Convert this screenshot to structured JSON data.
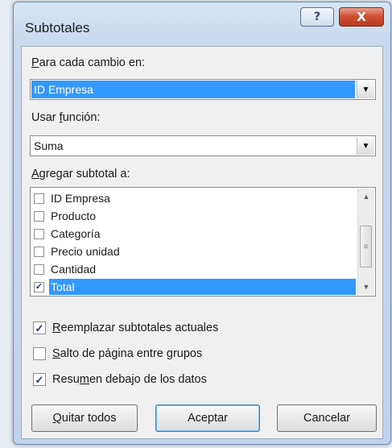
{
  "dialog": {
    "title": "Subtotales",
    "help_glyph": "?",
    "close_glyph": "X"
  },
  "group_by": {
    "label_first": "P",
    "label_rest": "ara cada cambio en:",
    "value": "ID Empresa"
  },
  "function": {
    "label_pre": "Usar ",
    "label_accel": "f",
    "label_post": "unción:",
    "value": "Suma"
  },
  "add_subtotal": {
    "label_first": "A",
    "label_rest": "gregar subtotal a:",
    "items": [
      {
        "label": "ID Empresa",
        "checked": false,
        "mark": "",
        "selected": false
      },
      {
        "label": "Producto",
        "checked": false,
        "mark": "",
        "selected": false
      },
      {
        "label": "Categoría",
        "checked": false,
        "mark": "",
        "selected": false
      },
      {
        "label": "Precio unidad",
        "checked": false,
        "mark": "",
        "selected": false
      },
      {
        "label": "Cantidad",
        "checked": false,
        "mark": "",
        "selected": false
      },
      {
        "label": "Total",
        "checked": true,
        "mark": "✓",
        "selected": true
      }
    ]
  },
  "options": {
    "replace": {
      "accel": "R",
      "rest": "eemplazar subtotales actuales",
      "checked": true,
      "mark": "✓"
    },
    "page_break": {
      "accel": "S",
      "rest": "alto de página entre grupos",
      "checked": false,
      "mark": ""
    },
    "summary_below": {
      "pre": "Resu",
      "accel": "m",
      "post": "en debajo de los datos",
      "checked": true,
      "mark": "✓"
    }
  },
  "buttons": {
    "remove_all_accel": "Q",
    "remove_all_rest": "uitar todos",
    "accept": "Aceptar",
    "cancel": "Cancelar"
  },
  "icons": {
    "dropdown": "chevron-down-icon",
    "scroll_up": "scroll-up-arrow-icon",
    "scroll_down": "scroll-down-arrow-icon",
    "check": "checkmark-icon"
  },
  "colors": {
    "selection": "#3399ff",
    "close_button": "#cf5136",
    "title_bar": "#c8daef"
  }
}
